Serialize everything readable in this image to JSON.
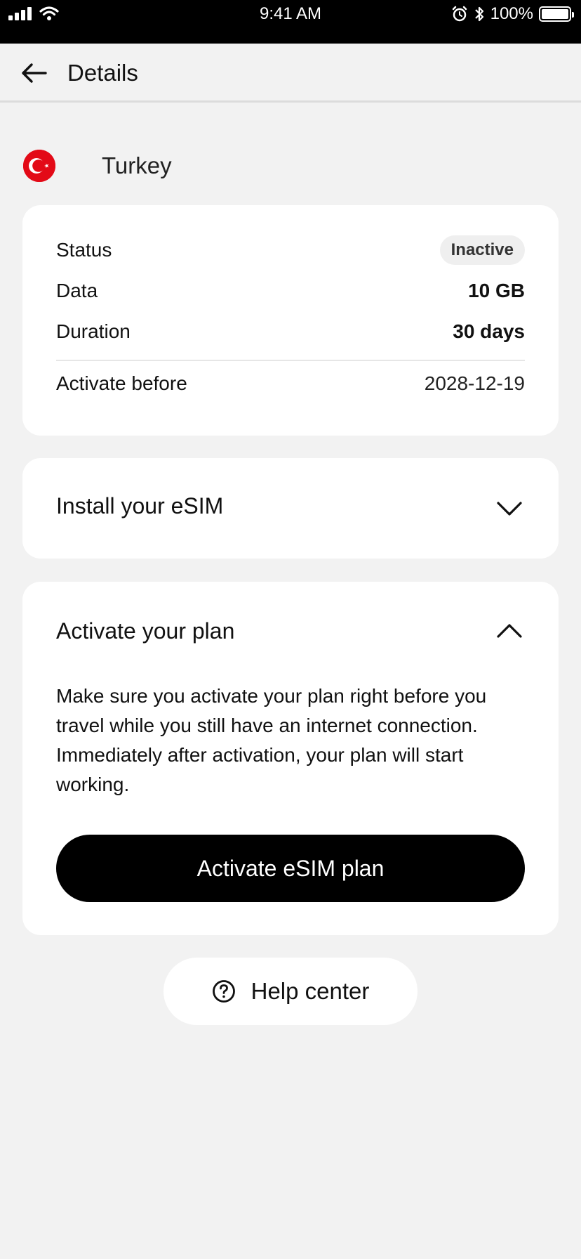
{
  "status_bar": {
    "time": "9:41 AM",
    "battery": "100%"
  },
  "header": {
    "title": "Details"
  },
  "country": {
    "name": "Turkey",
    "flag_color": "#e30a17"
  },
  "plan": {
    "status_label": "Status",
    "status_value": "Inactive",
    "data_label": "Data",
    "data_value": "10 GB",
    "duration_label": "Duration",
    "duration_value": "30 days",
    "activate_before_label": "Activate before",
    "activate_before_value": "2028-12-19"
  },
  "install_section": {
    "title": "Install your eSIM",
    "expanded": false
  },
  "activate_section": {
    "title": "Activate your plan",
    "expanded": true,
    "description": "Make sure you activate your plan right before you travel while you still have an internet connection. Immediately after activation, your plan will start working.",
    "button_label": "Activate eSIM plan"
  },
  "help": {
    "label": "Help center"
  },
  "colors": {
    "background": "#f2f2f2",
    "card": "#ffffff",
    "primary": "#000000",
    "badge_bg": "#efefef"
  }
}
